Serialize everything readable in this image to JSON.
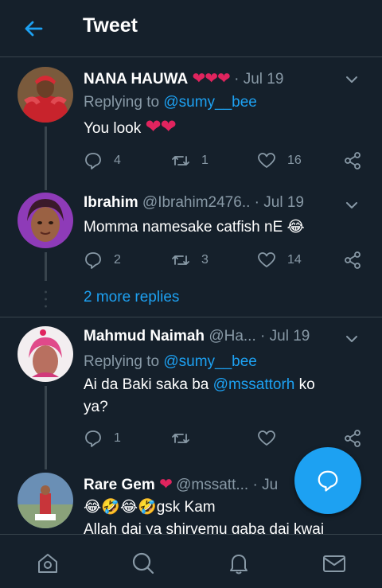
{
  "header": {
    "title": "Tweet"
  },
  "tweets": [
    {
      "name": "NANA HAUWA",
      "name_hearts": "❤❤❤",
      "handle": "",
      "dot": "·",
      "time": "Jul 19",
      "replying_prefix": "Replying to",
      "replying_to": "@sumy__bee",
      "text": "You look",
      "text_suffix": "❤❤",
      "replies": "4",
      "retweets": "1",
      "likes": "16"
    },
    {
      "name": "Ibrahim",
      "handle": "@Ibrahim2476..",
      "dot": "·",
      "time": "Jul 19",
      "text": "Momma namesake catfish nE",
      "text_suffix": "😂",
      "replies": "2",
      "retweets": "3",
      "likes": "14"
    },
    {
      "name": "Mahmud Naimah",
      "handle": "@Ha...",
      "dot": "·",
      "time": "Jul 19",
      "replying_prefix": "Replying to",
      "replying_to": "@sumy__bee",
      "text_pre": "Ai da Baki saka ba",
      "mention": "@mssattorh",
      "text_post": "ko",
      "text_line2": "ya?",
      "replies": "1",
      "retweets": "",
      "likes": ""
    },
    {
      "name": "Rare Gem",
      "name_hearts": "❤",
      "handle": "@mssatt...",
      "dot": "·",
      "time": "Ju",
      "text_line1": "😂🤣😂🤣gsk Kam",
      "text_line2": "Allah dai ya shiryemu gaba dai kwai"
    }
  ],
  "more_replies": "2 more replies",
  "nav": {
    "items": [
      "home-icon",
      "search-icon",
      "notifications-icon",
      "messages-icon"
    ]
  },
  "colors": {
    "background": "#15202b",
    "accent": "#1da1f2",
    "muted": "#8899a6",
    "heart": "#e0245e",
    "divider": "#38444d"
  }
}
